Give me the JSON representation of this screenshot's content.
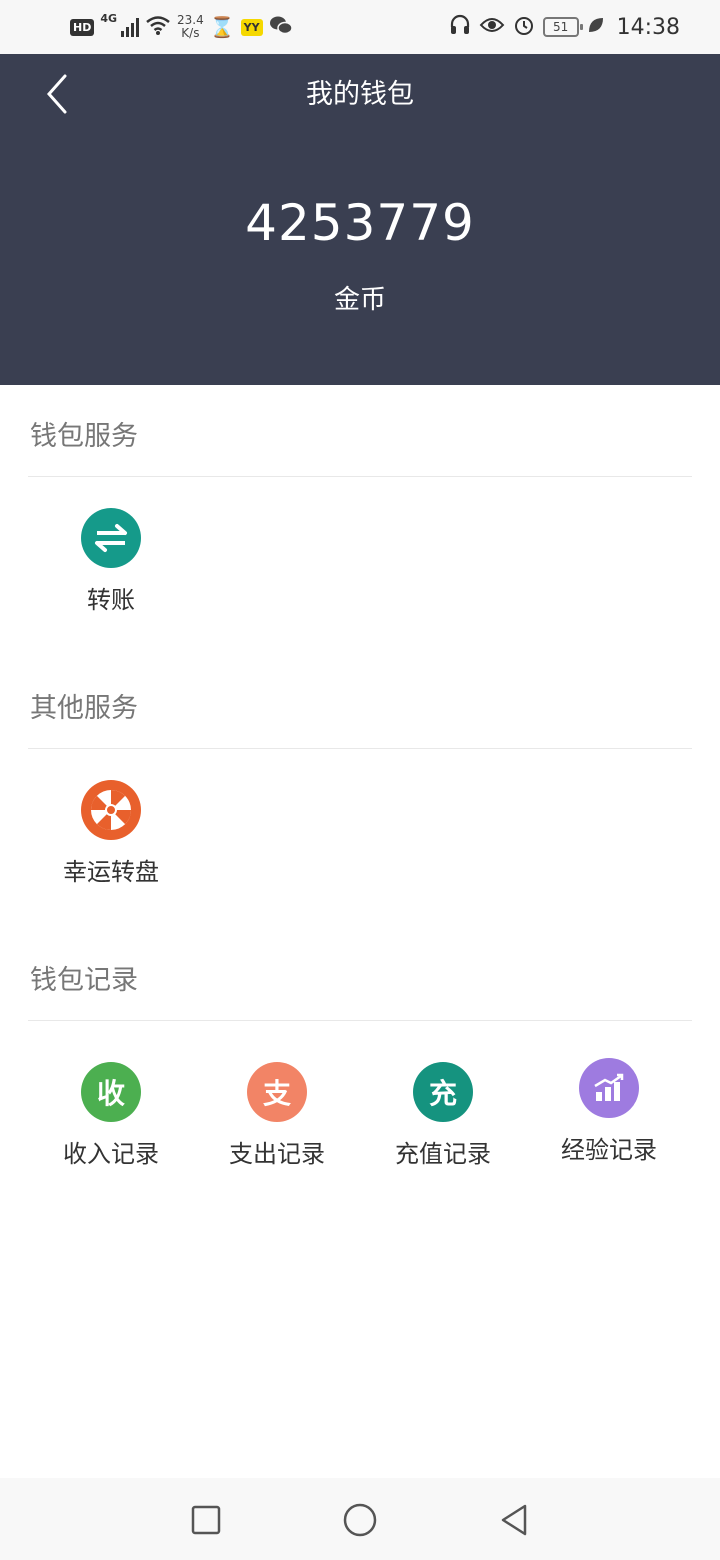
{
  "status_bar": {
    "hd": "HD",
    "network": "4G",
    "speed_value": "23.4",
    "speed_unit": "K/s",
    "yy": "YY",
    "battery": "51",
    "time": "14:38"
  },
  "header": {
    "title": "我的钱包",
    "balance": "4253779",
    "unit": "金币"
  },
  "sections": {
    "wallet_services": {
      "title": "钱包服务",
      "items": [
        {
          "label": "转账",
          "icon": "transfer-arrows-icon",
          "color": "#159a8a"
        }
      ]
    },
    "other_services": {
      "title": "其他服务",
      "items": [
        {
          "label": "幸运转盘",
          "icon": "lucky-wheel-icon",
          "color": "#e8602c"
        }
      ]
    },
    "wallet_records": {
      "title": "钱包记录",
      "items": [
        {
          "label": "收入记录",
          "icon_char": "收",
          "color": "#4caf50"
        },
        {
          "label": "支出记录",
          "icon_char": "支",
          "color": "#f28466"
        },
        {
          "label": "充值记录",
          "icon_char": "充",
          "color": "#15937f"
        },
        {
          "label": "经验记录",
          "icon": "bar-chart-icon",
          "color": "#9e7be0"
        }
      ]
    }
  },
  "colors": {
    "header_bg": "#3a3f51",
    "status_bar_bg": "#f7f7f7",
    "nav_bar_bg": "#f8f8f8"
  }
}
